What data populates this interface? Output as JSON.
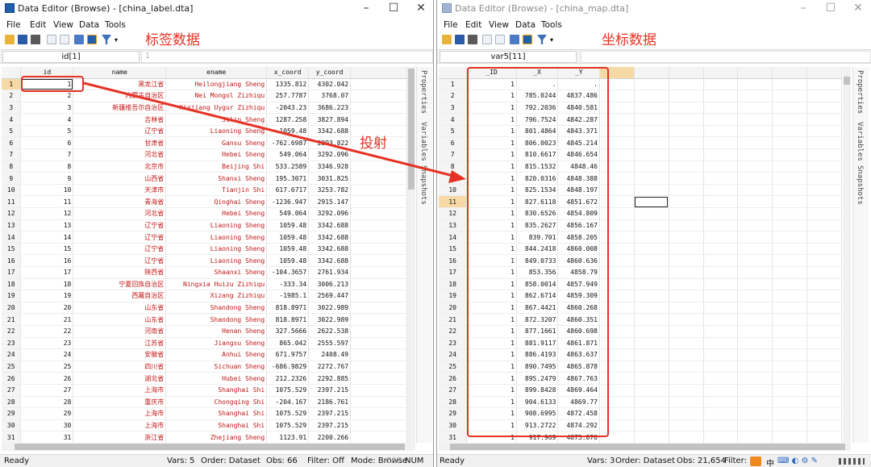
{
  "colors": {
    "annotation": "#e53224",
    "string_text": "#c21818",
    "row_highlight": "#f7d9a6"
  },
  "left": {
    "title": "Data Editor (Browse) - [china_label.dta]",
    "menu": [
      "File",
      "Edit",
      "View",
      "Data",
      "Tools"
    ],
    "namebox": "id[1]",
    "valbox": "1",
    "annotation": "标签数据",
    "columns": [
      "id",
      "name",
      "ename",
      "x_coord",
      "y_coord"
    ],
    "rows": [
      [
        "1",
        "1",
        "黑龙江省",
        "Heilongjiang Sheng",
        "1335.812",
        "4302.042"
      ],
      [
        "2",
        "2",
        "内蒙古自治区",
        "Nei Mongol Zizhiqu",
        "257.7787",
        "3768.07"
      ],
      [
        "3",
        "3",
        "新疆维吾尔自治区",
        "Xinjiang Uygur Zizhiqu",
        "-2043.23",
        "3686.223"
      ],
      [
        "4",
        "4",
        "吉林省",
        "Jilin Sheng",
        "1287.258",
        "3827.894"
      ],
      [
        "5",
        "5",
        "辽宁省",
        "Liaoning Sheng",
        "1059.48",
        "3342.688"
      ],
      [
        "6",
        "6",
        "甘肃省",
        "Gansu Sheng",
        "-762.6987",
        "2893.822"
      ],
      [
        "7",
        "7",
        "河北省",
        "Hebei Sheng",
        "549.064",
        "3292.096"
      ],
      [
        "8",
        "8",
        "北京市",
        "Beijing Shi",
        "533.2589",
        "3346.928"
      ],
      [
        "9",
        "9",
        "山西省",
        "Shanxi Sheng",
        "195.3071",
        "3031.825"
      ],
      [
        "10",
        "10",
        "天津市",
        "Tianjin Shi",
        "617.6717",
        "3253.782"
      ],
      [
        "11",
        "11",
        "青海省",
        "Qinghai Sheng",
        "-1236.947",
        "2915.147"
      ],
      [
        "12",
        "12",
        "河北省",
        "Hebei Sheng",
        "549.064",
        "3292.096"
      ],
      [
        "13",
        "13",
        "辽宁省",
        "Liaoning Sheng",
        "1059.48",
        "3342.688"
      ],
      [
        "14",
        "14",
        "辽宁省",
        "Liaoning Sheng",
        "1059.48",
        "3342.688"
      ],
      [
        "15",
        "15",
        "辽宁省",
        "Liaoning Sheng",
        "1059.48",
        "3342.688"
      ],
      [
        "16",
        "16",
        "辽宁省",
        "Liaoning Sheng",
        "1059.48",
        "3342.688"
      ],
      [
        "17",
        "17",
        "陕西省",
        "Shaanxi Sheng",
        "-104.3657",
        "2761.934"
      ],
      [
        "18",
        "18",
        "宁夏回族自治区",
        "Ningxia Huizu Zizhiqu",
        "-333.34",
        "3006.213"
      ],
      [
        "19",
        "19",
        "西藏自治区",
        "Xizang Zizhiqu",
        "-1985.1",
        "2569.447"
      ],
      [
        "20",
        "20",
        "山东省",
        "Shandong Sheng",
        "818.8971",
        "3022.989"
      ],
      [
        "21",
        "21",
        "山东省",
        "Shandong Sheng",
        "818.8971",
        "3022.989"
      ],
      [
        "22",
        "22",
        "河南省",
        "Henan Sheng",
        "327.5666",
        "2622.538"
      ],
      [
        "23",
        "23",
        "江苏省",
        "Jiangsu Sheng",
        "865.042",
        "2555.597"
      ],
      [
        "24",
        "24",
        "安徽省",
        "Anhui Sheng",
        "671.9757",
        "2408.49"
      ],
      [
        "25",
        "25",
        "四川省",
        "Sichuan Sheng",
        "-686.9829",
        "2272.767"
      ],
      [
        "26",
        "26",
        "湖北省",
        "Hubei Sheng",
        "212.2326",
        "2292.885"
      ],
      [
        "27",
        "27",
        "上海市",
        "Shanghai Shi",
        "1075.529",
        "2397.215"
      ],
      [
        "28",
        "28",
        "重庆市",
        "Chongqing Shi",
        "-204.167",
        "2186.761"
      ],
      [
        "29",
        "29",
        "上海市",
        "Shanghai Shi",
        "1075.529",
        "2397.215"
      ],
      [
        "30",
        "30",
        "上海市",
        "Shanghai Shi",
        "1075.529",
        "2397.215"
      ],
      [
        "31",
        "31",
        "浙江省",
        "Zhejiang Sheng",
        "1123.91",
        "2200.266"
      ]
    ],
    "sidepanel": [
      "Properties",
      "Variables",
      "Snapshots"
    ],
    "status": {
      "ready": "Ready",
      "vars": "Vars: 5",
      "order": "Order: Dataset",
      "obs": "Obs: 66",
      "filter": "Filter: Off",
      "mode": "Mode: Browse",
      "cap": "CAP",
      "num": "NUM"
    }
  },
  "arrow_label": "投射",
  "right": {
    "title": "Data Editor (Browse) - [china_map.dta]",
    "menu": [
      "File",
      "Edit",
      "View",
      "Data",
      "Tools"
    ],
    "namebox": "var5[11]",
    "annotation": "坐标数据",
    "columns": [
      "_ID",
      "_X",
      "_Y"
    ],
    "rows": [
      [
        "1",
        "1",
        ".",
        "."
      ],
      [
        "2",
        "1",
        "785.0244",
        "4837.486"
      ],
      [
        "3",
        "1",
        "792.2036",
        "4840.581"
      ],
      [
        "4",
        "1",
        "796.7524",
        "4842.287"
      ],
      [
        "5",
        "1",
        "801.4864",
        "4843.371"
      ],
      [
        "6",
        "1",
        "806.0023",
        "4845.214"
      ],
      [
        "7",
        "1",
        "810.6617",
        "4846.654"
      ],
      [
        "8",
        "1",
        "815.1532",
        "4848.46"
      ],
      [
        "9",
        "1",
        "820.0316",
        "4848.388"
      ],
      [
        "10",
        "1",
        "825.1534",
        "4848.197"
      ],
      [
        "11",
        "1",
        "827.6118",
        "4851.672"
      ],
      [
        "12",
        "1",
        "830.6526",
        "4854.809"
      ],
      [
        "13",
        "1",
        "835.2627",
        "4856.167"
      ],
      [
        "14",
        "1",
        "839.701",
        "4858.205"
      ],
      [
        "15",
        "1",
        "844.2418",
        "4860.008"
      ],
      [
        "16",
        "1",
        "849.0733",
        "4860.636"
      ],
      [
        "17",
        "1",
        "853.356",
        "4858.79"
      ],
      [
        "18",
        "1",
        "858.0014",
        "4857.949"
      ],
      [
        "19",
        "1",
        "862.6714",
        "4859.309"
      ],
      [
        "20",
        "1",
        "867.4421",
        "4860.268"
      ],
      [
        "21",
        "1",
        "872.3207",
        "4860.351"
      ],
      [
        "22",
        "1",
        "877.1661",
        "4860.698"
      ],
      [
        "23",
        "1",
        "881.9117",
        "4861.871"
      ],
      [
        "24",
        "1",
        "886.4193",
        "4863.637"
      ],
      [
        "25",
        "1",
        "890.7495",
        "4865.878"
      ],
      [
        "26",
        "1",
        "895.2479",
        "4867.763"
      ],
      [
        "27",
        "1",
        "899.8428",
        "4869.464"
      ],
      [
        "28",
        "1",
        "904.6133",
        "4869.77"
      ],
      [
        "29",
        "1",
        "908.6995",
        "4872.458"
      ],
      [
        "30",
        "1",
        "913.2722",
        "4874.292"
      ],
      [
        "31",
        "1",
        "917.969",
        "4875.876"
      ]
    ],
    "sidepanel": [
      "Properties",
      "Variables",
      "Snapshots"
    ],
    "status": {
      "ready": "Ready",
      "vars": "Vars: 3",
      "order": "Order: Dataset",
      "obs": "Obs: 21,654",
      "filter": "Filter:",
      "ime": "中"
    }
  }
}
